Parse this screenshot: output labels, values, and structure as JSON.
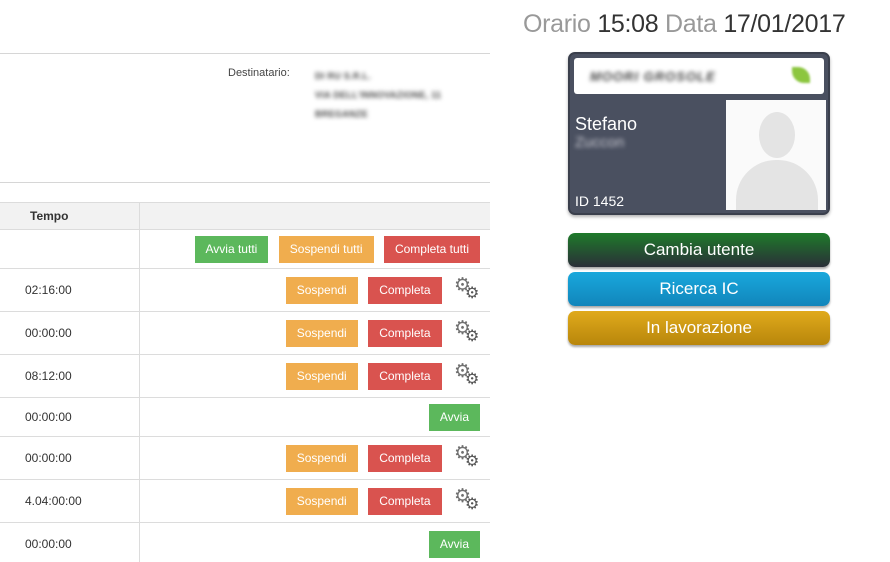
{
  "recipient": {
    "label": "Destinatario:",
    "lines": [
      "DI RU S.R.L.",
      "VIA DELL'INNOVAZIONE, 11",
      "BREGANZE"
    ]
  },
  "table": {
    "header_time": "Tempo",
    "bulk_actions": {
      "start_all": "Avvia tutti",
      "suspend_all": "Sospendi tutti",
      "complete_all": "Completa tutti"
    },
    "button_labels": {
      "suspend": "Sospendi",
      "complete": "Completa",
      "start": "Avvia"
    },
    "rows": [
      {
        "time": "02:16:00",
        "state": "running"
      },
      {
        "time": "00:00:00",
        "state": "running"
      },
      {
        "time": "08:12:00",
        "state": "running"
      },
      {
        "time": "00:00:00",
        "state": "idle"
      },
      {
        "time": "00:00:00",
        "state": "running"
      },
      {
        "time": "4.04:00:00",
        "state": "running"
      },
      {
        "time": "00:00:00",
        "state": "idle"
      }
    ]
  },
  "clock": {
    "time_label": "Orario",
    "time_value": "15:08",
    "date_label": "Data",
    "date_value": "17/01/2017"
  },
  "badge": {
    "logo_text": "MOORI GROSOLE",
    "first_name": "Stefano",
    "last_name": "Zuccon",
    "id_text": "ID 1452"
  },
  "actions": {
    "change_user": "Cambia utente",
    "search_ic": "Ricerca IC",
    "in_progress": "In lavorazione"
  },
  "icons": {
    "gear": "gear-icon",
    "photo": "avatar-placeholder-icon"
  },
  "colors": {
    "green": "#5cb85c",
    "orange": "#f0ad4e",
    "red": "#d9534f",
    "badge_bg": "#4a5060",
    "btn_user": "#1e7a2a",
    "btn_search": "#19a8dc",
    "btn_work": "#e0aa1c"
  }
}
